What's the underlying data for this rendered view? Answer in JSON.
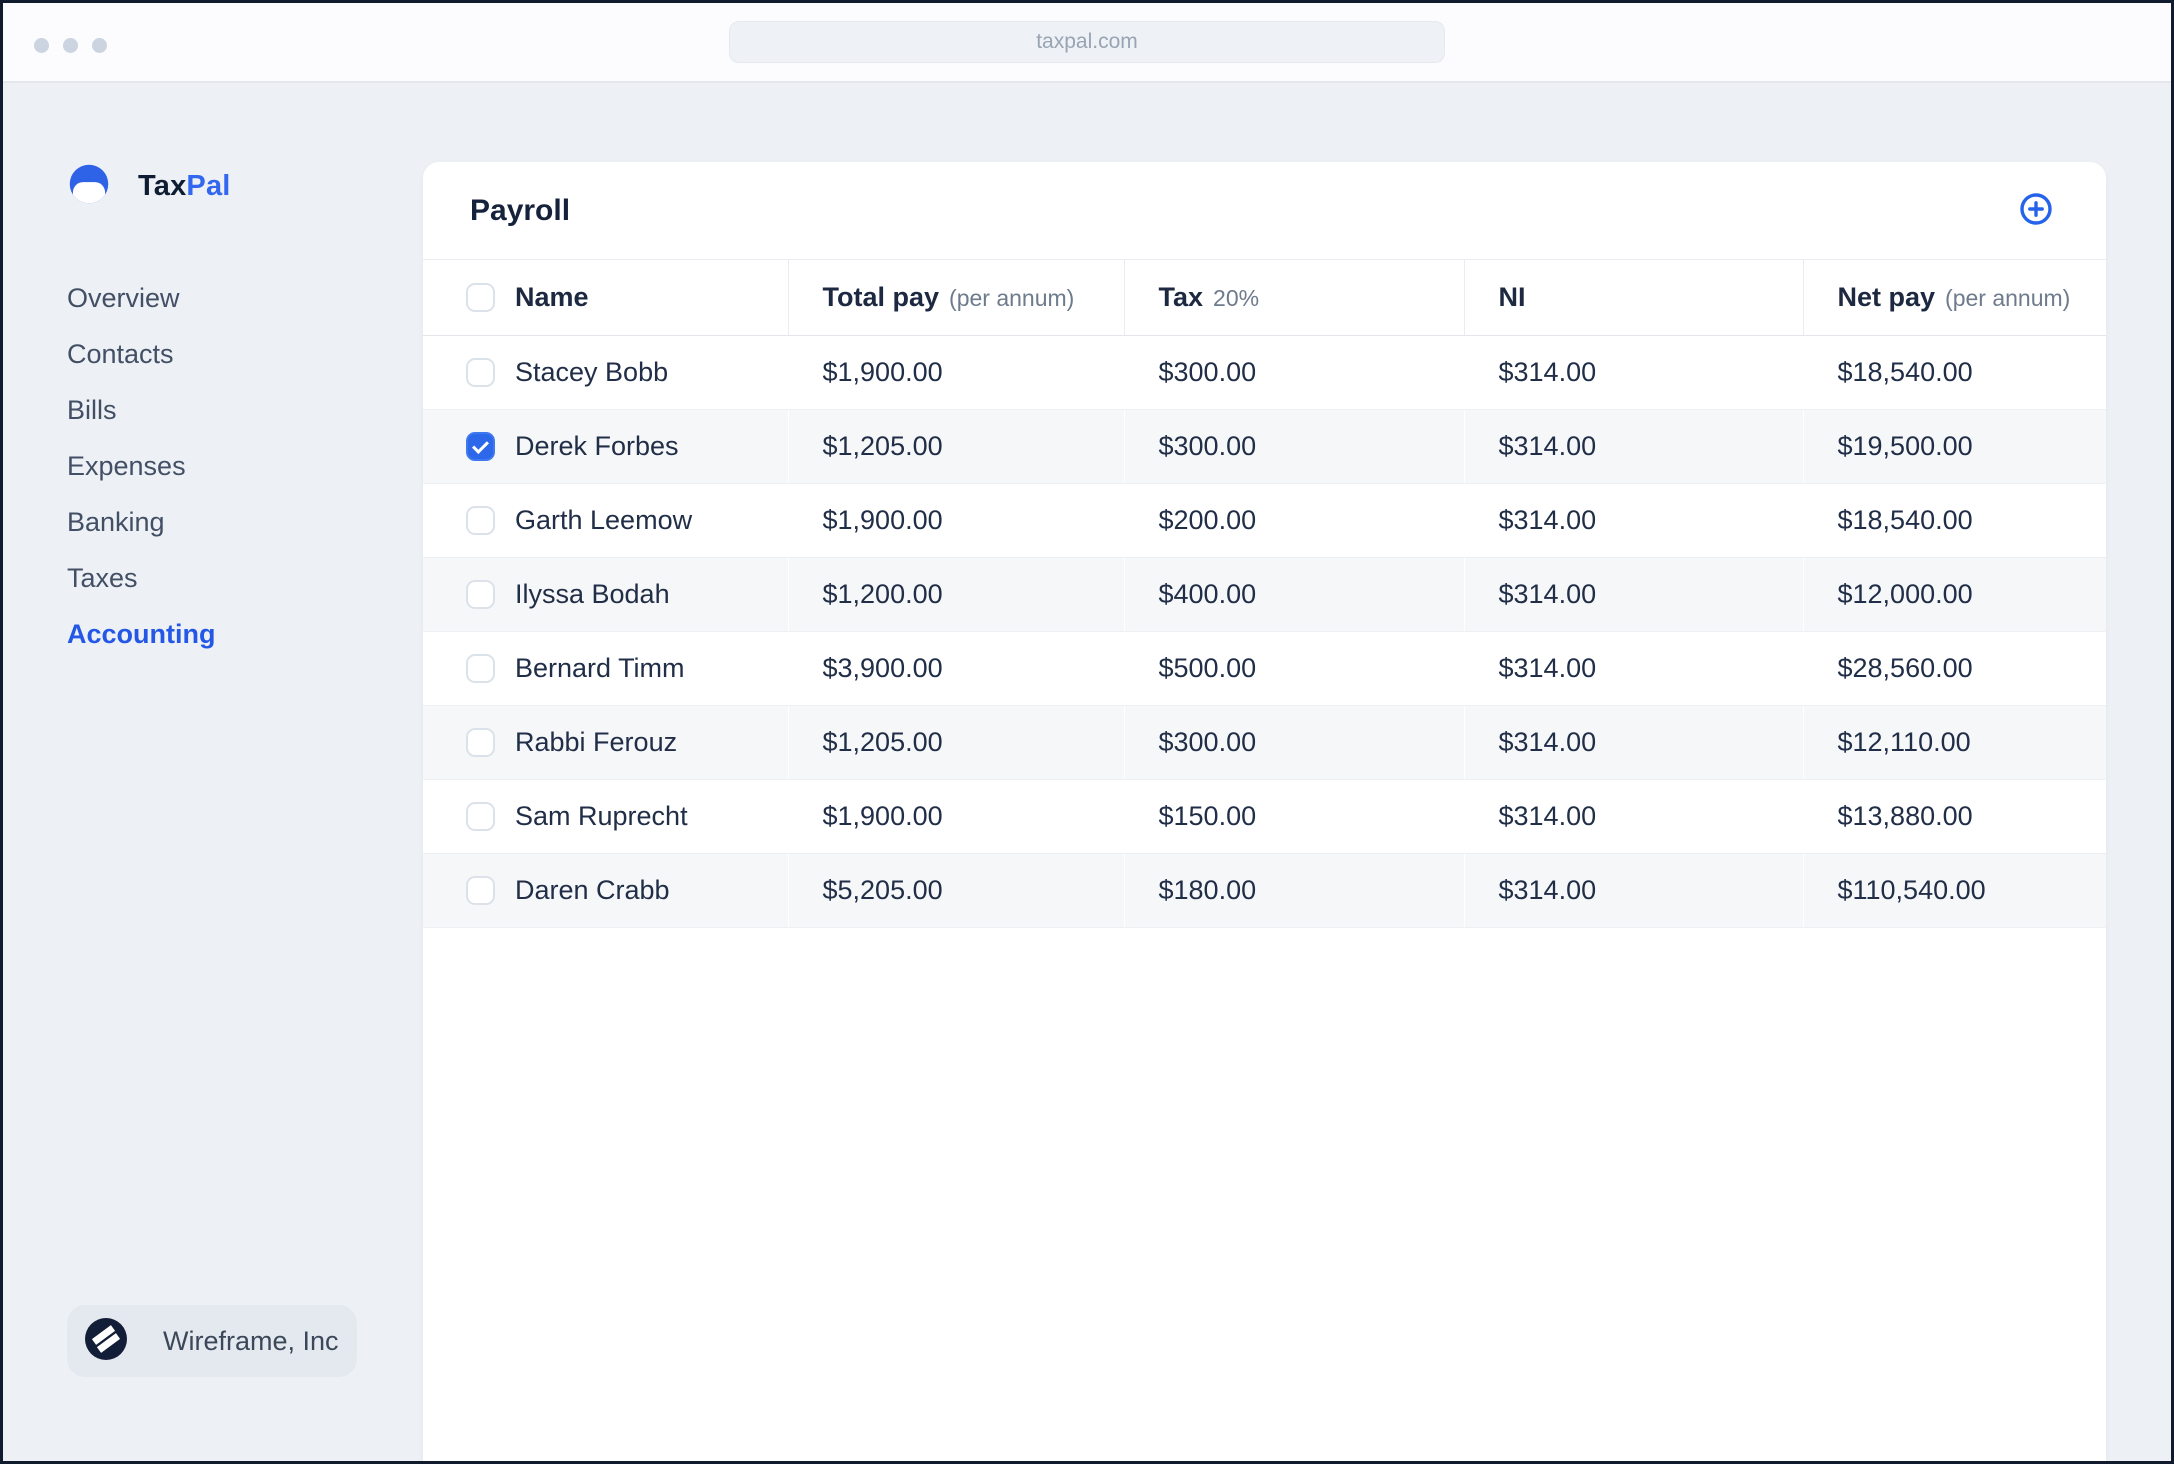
{
  "browser": {
    "url": "taxpal.com"
  },
  "brand": {
    "name_part1": "Tax",
    "name_part2": "Pal"
  },
  "sidebar": {
    "items": [
      {
        "label": "Overview",
        "active": false
      },
      {
        "label": "Contacts",
        "active": false
      },
      {
        "label": "Bills",
        "active": false
      },
      {
        "label": "Expenses",
        "active": false
      },
      {
        "label": "Banking",
        "active": false
      },
      {
        "label": "Taxes",
        "active": false
      },
      {
        "label": "Accounting",
        "active": true
      }
    ],
    "org_name": "Wireframe, Inc"
  },
  "payroll": {
    "title": "Payroll",
    "columns": [
      {
        "label": "Name",
        "suffix": ""
      },
      {
        "label": "Total pay",
        "suffix": "(per annum)"
      },
      {
        "label": "Tax",
        "suffix": "20%"
      },
      {
        "label": "NI",
        "suffix": ""
      },
      {
        "label": "Net pay",
        "suffix": "(per annum)"
      }
    ],
    "rows": [
      {
        "name": "Stacey Bobb",
        "checked": false,
        "total_pay": "$1,900.00",
        "tax": "$300.00",
        "ni": "$314.00",
        "net_pay": "$18,540.00"
      },
      {
        "name": "Derek Forbes",
        "checked": true,
        "total_pay": "$1,205.00",
        "tax": "$300.00",
        "ni": "$314.00",
        "net_pay": "$19,500.00"
      },
      {
        "name": "Garth Leemow",
        "checked": false,
        "total_pay": "$1,900.00",
        "tax": "$200.00",
        "ni": "$314.00",
        "net_pay": "$18,540.00"
      },
      {
        "name": "Ilyssa Bodah",
        "checked": false,
        "total_pay": "$1,200.00",
        "tax": "$400.00",
        "ni": "$314.00",
        "net_pay": "$12,000.00"
      },
      {
        "name": "Bernard Timm",
        "checked": false,
        "total_pay": "$3,900.00",
        "tax": "$500.00",
        "ni": "$314.00",
        "net_pay": "$28,560.00"
      },
      {
        "name": "Rabbi Ferouz",
        "checked": false,
        "total_pay": "$1,205.00",
        "tax": "$300.00",
        "ni": "$314.00",
        "net_pay": "$12,110.00"
      },
      {
        "name": "Sam Ruprecht",
        "checked": false,
        "total_pay": "$1,900.00",
        "tax": "$150.00",
        "ni": "$314.00",
        "net_pay": "$13,880.00"
      },
      {
        "name": "Daren Crabb",
        "checked": false,
        "total_pay": "$5,205.00",
        "tax": "$180.00",
        "ni": "$314.00",
        "net_pay": "$110,540.00"
      }
    ]
  },
  "icons": {
    "window_dots": "window-control-dots",
    "logo": "taxpal-logo",
    "org_logo": "wireframe-logo",
    "add": "circle-plus-icon"
  },
  "colors": {
    "accent_blue": "#2563eb",
    "checkbox_checked": "#2e68ea",
    "active_nav": "#2457e5",
    "page_bg": "#edf1f6",
    "card_bg": "#ffffff",
    "stripe_bg": "#f6f7f9",
    "text_dark": "#1c2940",
    "text_muted": "#6e7b8c",
    "frame_border": "#101b2e"
  }
}
